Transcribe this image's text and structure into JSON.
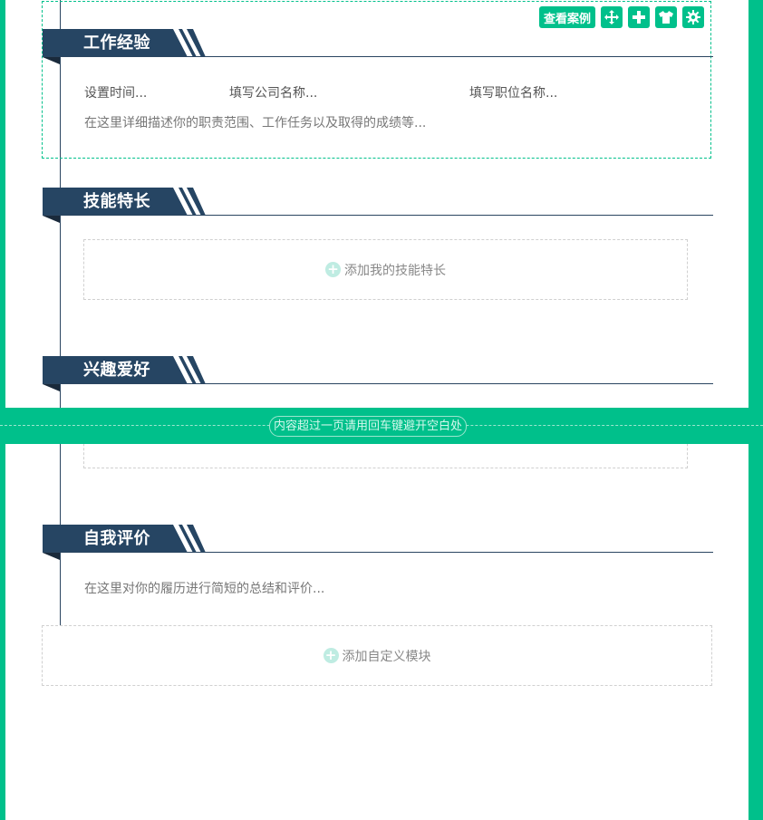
{
  "toolbar": {
    "view_example_label": "查看案例",
    "icons": [
      "move-icon",
      "plus-icon",
      "shirt-icon",
      "gear-icon"
    ]
  },
  "colors": {
    "accent": "#00c08b",
    "banner": "#264563",
    "text": "#555555"
  },
  "sections": {
    "work": {
      "title": "工作经验",
      "time_placeholder": "设置时间...",
      "company_placeholder": "填写公司名称...",
      "position_placeholder": "填写职位名称...",
      "description_placeholder": "在这里详细描述你的职责范围、工作任务以及取得的成绩等..."
    },
    "skills": {
      "title": "技能特长",
      "add_label": "添加我的技能特长"
    },
    "hobbies": {
      "title": "兴趣爱好"
    },
    "self_eval": {
      "title": "自我评价",
      "placeholder": "在这里对你的履历进行简短的总结和评价..."
    }
  },
  "add_custom_module": "添加自定义模块",
  "page_break_notice": "内容超过一页请用回车键避开空白处"
}
